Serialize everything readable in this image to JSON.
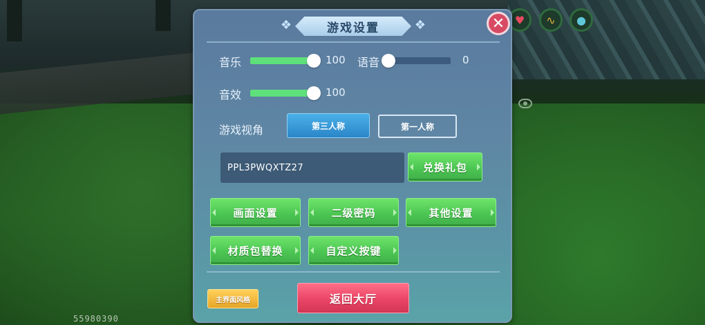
{
  "dialog": {
    "title": "游戏设置",
    "close_icon": "close-icon"
  },
  "audio": {
    "music_label": "音乐",
    "music_value": "100",
    "music_level": 1.0,
    "voice_label": "语音",
    "voice_value": "0",
    "voice_level": 0.0,
    "sfx_label": "音效",
    "sfx_value": "100",
    "sfx_level": 1.0
  },
  "view": {
    "label": "游戏视角",
    "third_person": "第三人称",
    "first_person": "第一人称",
    "selected": "third_person"
  },
  "gift": {
    "code_value": "PPL3PWQXTZ27",
    "redeem_label": "兑换礼包"
  },
  "settings_buttons": {
    "graphics": "画面设置",
    "secondary_password": "二级密码",
    "other": "其他设置",
    "texture_pack": "材质包替换",
    "custom_keys": "自定义按键"
  },
  "footer": {
    "main_style": "主界面风格",
    "return_lobby": "返回大厅"
  },
  "hud": {
    "uid": "55980390",
    "icons": [
      "heart-icon",
      "hunger-icon",
      "water-icon",
      "eye-icon"
    ]
  },
  "colors": {
    "slider_fill": "#5ee07a",
    "green_button": "#4cc653",
    "return_button": "#ea4566",
    "style_button": "#f0b53a",
    "active_view": "#2b86c8"
  }
}
